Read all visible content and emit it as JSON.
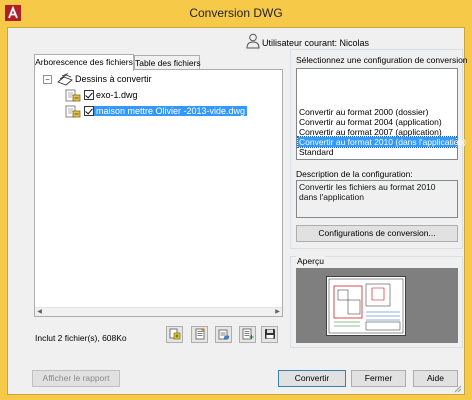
{
  "window": {
    "title": "Conversion DWG"
  },
  "user": {
    "label": "Utilisateur courant: Nicolas",
    "icon": "user-icon"
  },
  "tabs": [
    {
      "label": "Arborescence des fichiers",
      "active": true
    },
    {
      "label": "Table des fichiers",
      "active": false
    }
  ],
  "tree": {
    "root": {
      "label": "Dessins à convertir",
      "expanded": true,
      "icon": "drawings-folder-icon"
    },
    "files": [
      {
        "label": "exo-1.dwg",
        "checked": true,
        "selected": false,
        "icon": "dwg-file-icon"
      },
      {
        "label": "maison mettre Olivier -2013-vide.dwg",
        "checked": true,
        "selected": true,
        "icon": "dwg-file-icon"
      }
    ]
  },
  "summary": "Inclut 2 fichier(s), 608Ko",
  "toolbar": {
    "icons": [
      "add-file-icon",
      "add-list-icon",
      "open-list-icon",
      "append-list-icon",
      "save-list-icon"
    ]
  },
  "config": {
    "prompt": "Sélectionnez une configuration de conversion",
    "options": [
      "Convertir au format 2000 (dossier)",
      "Convertir au format 2004 (application)",
      "Convertir au format 2007 (application)",
      "Convertir au format 2010 (dans l'application)",
      "Standard"
    ],
    "selected_index": 3,
    "description_label": "Description de la configuration:",
    "description": "Convertir les fichiers au format 2010 dans l'application",
    "configs_button": "Configurations de conversion..."
  },
  "preview": {
    "label": "Aperçu"
  },
  "buttons": {
    "report": "Afficher le rapport",
    "convert": "Convertir",
    "close": "Fermer",
    "help": "Aide"
  },
  "colors": {
    "title_bar": "#f7c948",
    "selection": "#3399ff",
    "preview_bg": "#7f7f7f"
  }
}
